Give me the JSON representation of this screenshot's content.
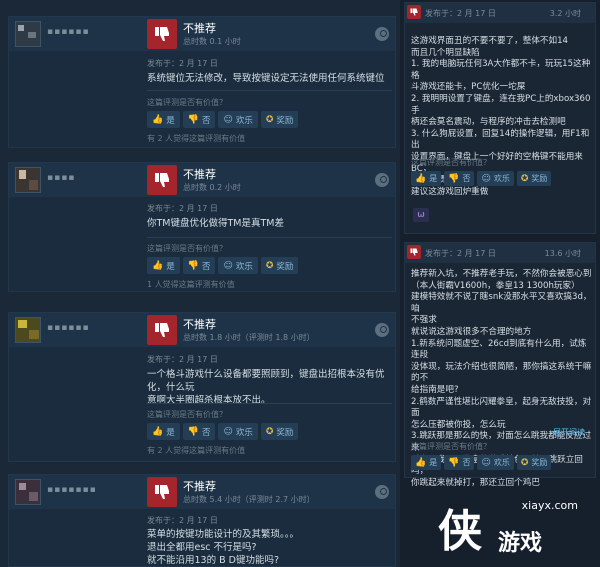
{
  "colors": {
    "thumb_down": "#a4262c",
    "accent_link": "#66c0f4",
    "award": "#e1b94a"
  },
  "icons": {
    "thumb": "thumbs-down-icon",
    "steam": "steam-logo-icon",
    "yes": "thumbs-up-icon",
    "no": "thumbs-down-icon",
    "funny": "laugh-icon",
    "award": "award-icon"
  },
  "buttons": {
    "yes": "是",
    "no": "否",
    "funny": "欢乐",
    "award": "奖励"
  },
  "helpful_question": "这篇评测是否有价值？",
  "left_reviews": [
    {
      "verdict": "不推荐",
      "hours": "总时数 0.1 小时",
      "posted": "发布于：2 月 17 日",
      "lines": [
        "系统键位无法修改，导致按键设定无法使用任何系统键位"
      ],
      "helpful": "有 2 人觉得这篇评测有价值"
    },
    {
      "verdict": "不推荐",
      "hours": "总时数 0.2 小时",
      "posted": "发布于：2 月 17 日",
      "lines": [
        "你TM键盘优化做得TM是真TM差"
      ],
      "helpful": "1 人觉得这篇评测有价值"
    },
    {
      "verdict": "不推荐",
      "hours": "总时数 1.8 小时（评测时 1.8 小时）",
      "posted": "发布于：2 月 17 日",
      "lines": [
        "一个格斗游戏什么设备都要照顾到，键盘出招根本没有优化，什么玩",
        "意啊大半圈超杀根本放不出。"
      ],
      "helpful": "有 2 人觉得这篇评测有价值"
    },
    {
      "verdict": "不推荐",
      "hours": "总时数 5.4 小时（评测时 2.7 小时）",
      "posted": "发布于：2 月 17 日",
      "lines": [
        "菜单的按键功能设计的及其繁琐。。。",
        "退出全都用esc 不行是吗?",
        "就不能沿用13的 B D键功能吗?"
      ],
      "helpful": ""
    }
  ],
  "right_reviews": [
    {
      "posted": "发布于：2 月 17 日",
      "hours": "3.2 小时",
      "lines": [
        "这游戏界面丑的不要不要了，整体不如14",
        "而且几个明显缺陷",
        "1. 我的电脑玩任何3A大作都不卡，玩玩15这种格",
        "斗游戏还能卡，PC优化一坨屎",
        "2. 我明明设置了键盘，连在我PC上的xbox360手",
        "柄还会莫名震动，与程序的冲击去检测吧",
        "3. 什么狗屁设置，回复14的操作逻辑，用F1和出",
        "设置界面，键盘上一个好好的空格键不能用来BC，",
        "很不习惯",
        "建议这游戏回炉重做"
      ],
      "helpful": "",
      "emoji": "ω"
    },
    {
      "posted": "发布于：2 月 17 日",
      "hours": "13.6 小时",
      "lines": [
        "推荐新入坑，不推荐老手玩，不然你会被恶心到",
        "（本人街霸V1600h，拳皇13 1300h玩家）",
        "建模特效就不说了瞎snk没那水平又喜欢搞3d，咱",
        "不强求",
        "就说说这游戏很多不合理的地方",
        "1.新系统问题虚空、26cd到底有什么用，试炼连段",
        "没体现，玩法介绍也很简陋，那你搞这系统干嘛的不",
        "给指南是吧?",
        "2.鹤数严谨性堪比闪耀拳皇，起身无敌技投，对面",
        "怎么压都被你投，怎么玩",
        "3.跳跃那是那么的快，对面怎么跳我都能反应过来",
        "对空，我寻思拳皇的游戏特色不就是跳跃立回吗，",
        "你跳起来就掉打，那还立回个鸡巴"
      ],
      "expand": "展开阅读",
      "helpful": ""
    }
  ],
  "watermark": {
    "site": "xiayx.com",
    "big": "侠",
    "small": "游戏"
  }
}
